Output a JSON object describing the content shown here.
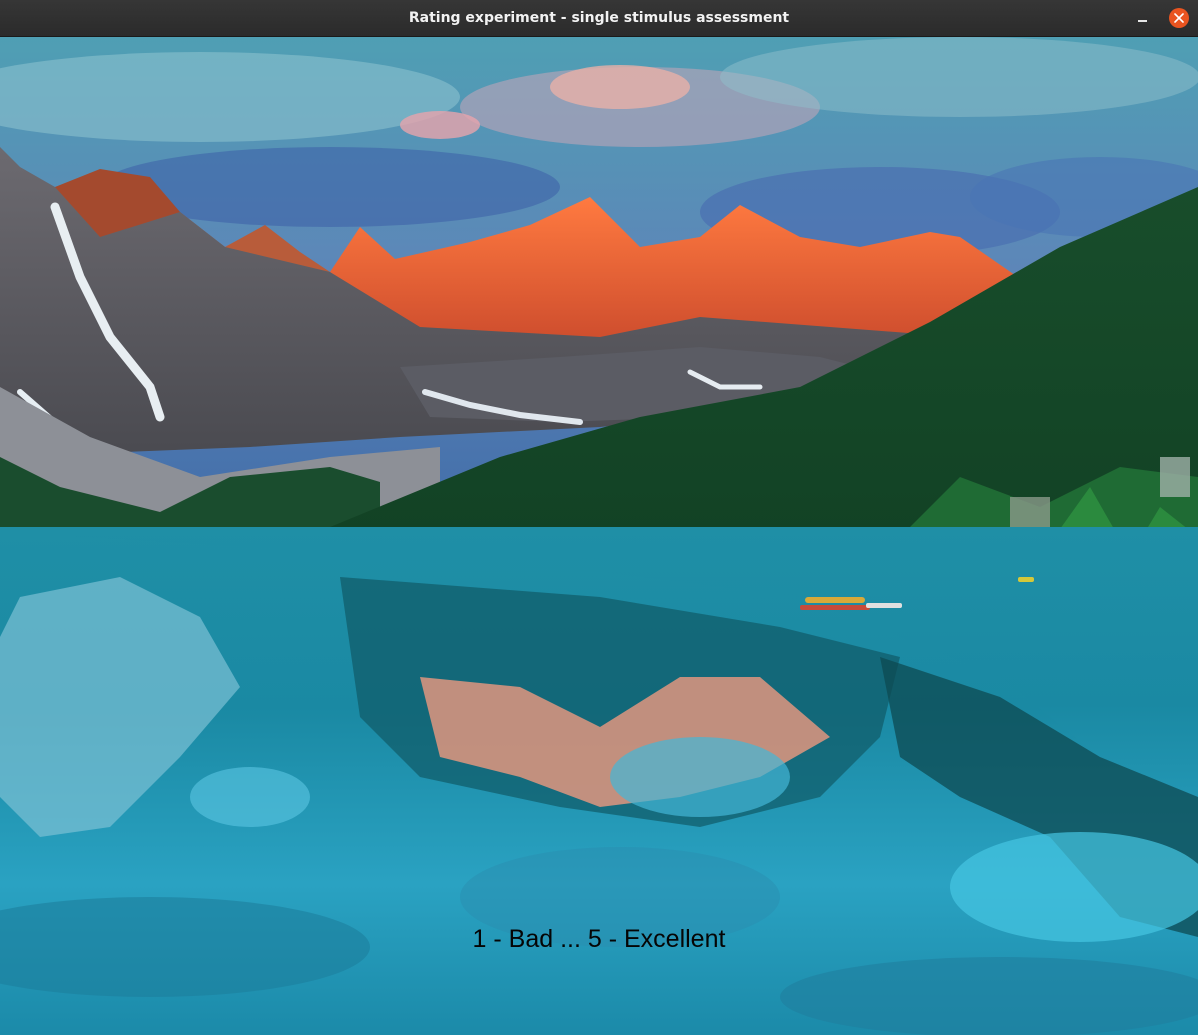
{
  "window": {
    "title": "Rating experiment - single stimulus assessment",
    "controls": {
      "minimize_icon": "minimize-icon",
      "close_icon": "close-icon",
      "close_color": "#e95420"
    }
  },
  "stimulus": {
    "rating_hint": "1 - Bad ... 5 - Excellent"
  }
}
